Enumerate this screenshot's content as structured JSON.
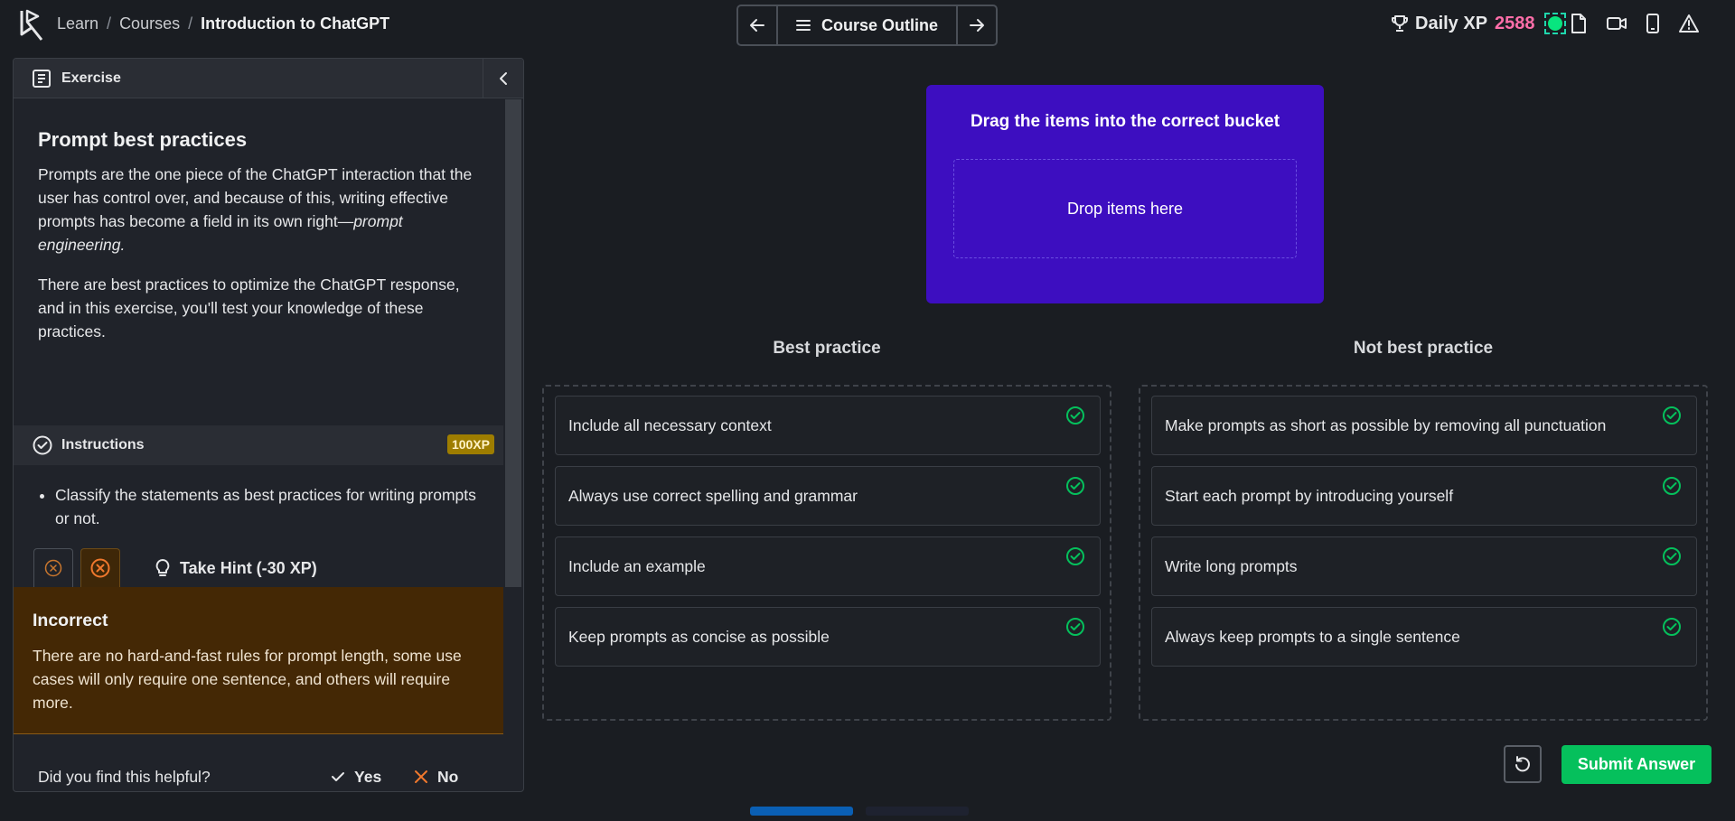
{
  "topbar": {
    "breadcrumbs": [
      "Learn",
      "Courses",
      "Introduction to ChatGPT"
    ],
    "separator": "/",
    "outline_label": "Course Outline",
    "xp_label": "Daily XP",
    "xp_value": "2588"
  },
  "exercise": {
    "header_label": "Exercise",
    "title": "Prompt best practices",
    "paragraph1_main": "Prompts are the one piece of the ChatGPT interaction that the user has control over, and because of this, writing effective prompts has become a field in its own right—",
    "paragraph1_italic": "prompt engineering.",
    "paragraph2": "There are best practices to optimize the ChatGPT response, and in this exercise, you'll test your knowledge of these practices."
  },
  "instructions": {
    "label": "Instructions",
    "xp_badge": "100XP",
    "items": [
      "Classify the statements as best practices for writing prompts or not."
    ],
    "hint_label": "Take Hint (-30 XP)"
  },
  "feedback": {
    "title": "Incorrect",
    "text": "There are no hard-and-fast rules for prompt length, some use cases will only require one sentence, and others will require more.",
    "helpful_question": "Did you find this helpful?",
    "yes_label": "Yes",
    "no_label": "No"
  },
  "dragdrop": {
    "title": "Drag the items into the correct bucket",
    "drop_placeholder": "Drop items here"
  },
  "buckets": [
    {
      "title": "Best practice",
      "items": [
        "Include all necessary context",
        "Always use correct spelling and grammar",
        "Include an example",
        "Keep prompts as concise as possible"
      ]
    },
    {
      "title": "Not best practice",
      "items": [
        "Make prompts as short as possible by removing all punctuation",
        "Start each prompt by introducing yourself",
        "Write long prompts",
        "Always keep prompts to a single sentence"
      ]
    }
  ],
  "actions": {
    "submit_label": "Submit Answer"
  },
  "colors": {
    "accent_purple": "#3d0ec0",
    "success_green": "#05c05c",
    "xp_pink": "#ff6ea9",
    "warning_orange": "#f0782d"
  },
  "icons": {
    "logo": "datacamp-logo-icon",
    "back": "arrow-left-icon",
    "forward": "arrow-right-icon",
    "outline": "menu-icon",
    "trophy": "trophy-icon",
    "slides": "document-icon",
    "video": "video-icon",
    "mobile": "mobile-icon",
    "report": "warning-icon",
    "check": "check-circle-icon",
    "hint": "lightbulb-icon",
    "reset": "reset-icon"
  },
  "progress": {
    "current_step": 1,
    "total_steps": 2
  }
}
